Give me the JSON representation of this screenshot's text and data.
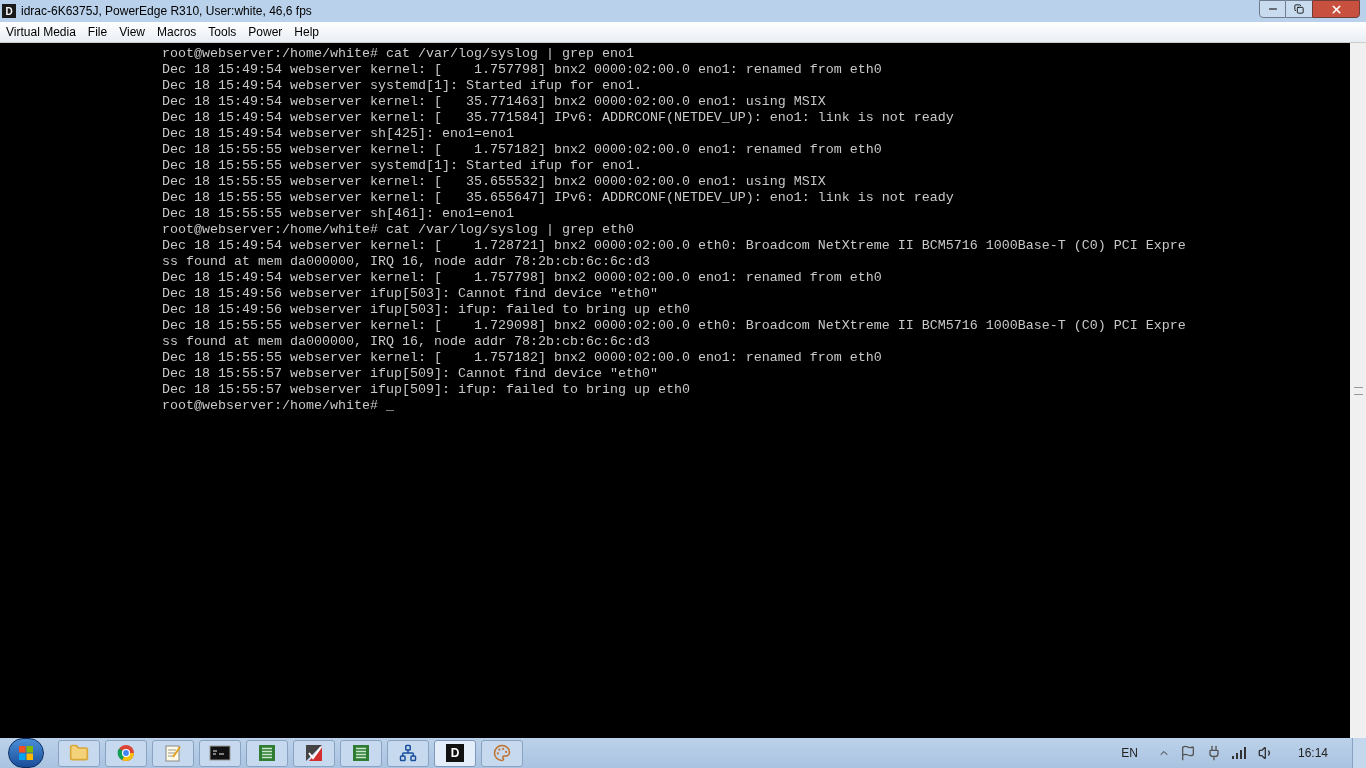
{
  "window": {
    "app_icon_text": "D",
    "title": "idrac-6K6375J, PowerEdge R310, User:white, 46,6 fps"
  },
  "menu": [
    "Virtual Media",
    "File",
    "View",
    "Macros",
    "Tools",
    "Power",
    "Help"
  ],
  "terminal": {
    "lines": [
      "root@webserver:/home/white# cat /var/log/syslog | grep eno1",
      "Dec 18 15:49:54 webserver kernel: [    1.757798] bnx2 0000:02:00.0 eno1: renamed from eth0",
      "Dec 18 15:49:54 webserver systemd[1]: Started ifup for eno1.",
      "Dec 18 15:49:54 webserver kernel: [   35.771463] bnx2 0000:02:00.0 eno1: using MSIX",
      "Dec 18 15:49:54 webserver kernel: [   35.771584] IPv6: ADDRCONF(NETDEV_UP): eno1: link is not ready",
      "Dec 18 15:49:54 webserver sh[425]: eno1=eno1",
      "Dec 18 15:55:55 webserver kernel: [    1.757182] bnx2 0000:02:00.0 eno1: renamed from eth0",
      "Dec 18 15:55:55 webserver systemd[1]: Started ifup for eno1.",
      "Dec 18 15:55:55 webserver kernel: [   35.655532] bnx2 0000:02:00.0 eno1: using MSIX",
      "Dec 18 15:55:55 webserver kernel: [   35.655647] IPv6: ADDRCONF(NETDEV_UP): eno1: link is not ready",
      "Dec 18 15:55:55 webserver sh[461]: eno1=eno1",
      "root@webserver:/home/white# cat /var/log/syslog | grep eth0",
      "Dec 18 15:49:54 webserver kernel: [    1.728721] bnx2 0000:02:00.0 eth0: Broadcom NetXtreme II BCM5716 1000Base-T (C0) PCI Expre",
      "ss found at mem da000000, IRQ 16, node addr 78:2b:cb:6c:6c:d3",
      "Dec 18 15:49:54 webserver kernel: [    1.757798] bnx2 0000:02:00.0 eno1: renamed from eth0",
      "Dec 18 15:49:56 webserver ifup[503]: Cannot find device \"eth0\"",
      "Dec 18 15:49:56 webserver ifup[503]: ifup: failed to bring up eth0",
      "Dec 18 15:55:55 webserver kernel: [    1.729098] bnx2 0000:02:00.0 eth0: Broadcom NetXtreme II BCM5716 1000Base-T (C0) PCI Expre",
      "ss found at mem da000000, IRQ 16, node addr 78:2b:cb:6c:6c:d3",
      "Dec 18 15:55:55 webserver kernel: [    1.757182] bnx2 0000:02:00.0 eno1: renamed from eth0",
      "Dec 18 15:55:57 webserver ifup[509]: Cannot find device \"eth0\"",
      "Dec 18 15:55:57 webserver ifup[509]: ifup: failed to bring up eth0"
    ],
    "prompt": "root@webserver:/home/white# ",
    "cursor": "_"
  },
  "taskbar": {
    "items": [
      {
        "kind": "folder",
        "selected": false
      },
      {
        "kind": "browser",
        "selected": false
      },
      {
        "kind": "notepad",
        "selected": false
      },
      {
        "kind": "console",
        "selected": false
      },
      {
        "kind": "list",
        "selected": false
      },
      {
        "kind": "check",
        "selected": false
      },
      {
        "kind": "list",
        "selected": false
      },
      {
        "kind": "network",
        "selected": false
      },
      {
        "kind": "logo",
        "text": "D",
        "selected": true
      },
      {
        "kind": "paint",
        "selected": false
      }
    ],
    "language": "EN",
    "clock": "16:14"
  }
}
